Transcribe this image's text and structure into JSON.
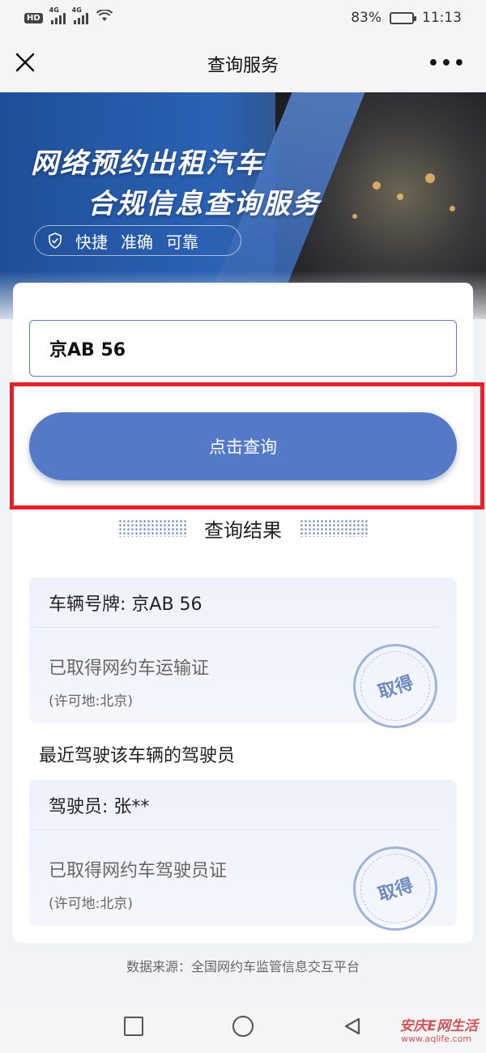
{
  "status_bar": {
    "hd": "HD",
    "sig1": "4G",
    "sig2": "4G",
    "battery_pct": "83%",
    "battery_level": 0.83,
    "time": "11:13"
  },
  "nav": {
    "title": "查询服务",
    "more": "•••"
  },
  "banner": {
    "title_line1": "网络预约出租汽车",
    "title_line2": "合规信息查询服务",
    "tags": [
      "快捷",
      "准确",
      "可靠"
    ]
  },
  "search": {
    "plate_value": "京AB  56"
  },
  "query_button_label": "点击查询",
  "result": {
    "title": "查询结果",
    "vehicle": {
      "plate_label": "车辆号牌: 京AB  56",
      "status": "已取得网约车运输证",
      "place": "(许可地:北京)",
      "stamp": "取得"
    },
    "driver_heading": "最近驾驶该车辆的驾驶员",
    "driver": {
      "name_label": "驾驶员: 张**",
      "status": "已取得网约车驾驶员证",
      "place": "(许可地:北京)",
      "stamp": "取得"
    }
  },
  "footer_source": "数据来源：全国网约车监管信息交互平台",
  "watermark": {
    "text": "安庆E网生活",
    "url": "www.aqlife.com"
  },
  "colors": {
    "primary": "#5479c6",
    "highlight": "#e8202c"
  }
}
